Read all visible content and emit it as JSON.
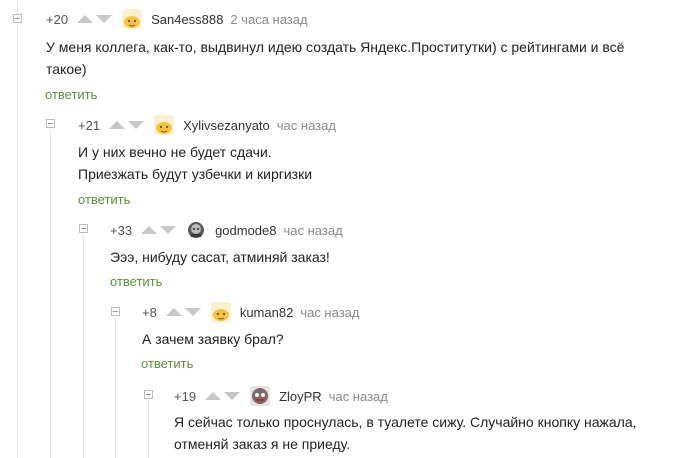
{
  "comments": [
    {
      "rating": "+20",
      "author": "San4ess888",
      "time": "2 часа назад",
      "lines": [
        "У меня коллега, как-то, выдвинул идею создать Яндекс.Проститутки) с рейтингами и всё",
        "такое)"
      ],
      "reply_label": "ответить",
      "avatar_color": "#f6c443"
    },
    {
      "rating": "+21",
      "author": "Xylivsezanyato",
      "time": "час назад",
      "lines": [
        "И у них вечно не будет сдачи.",
        "Приезжать будут узбечки и киргизки"
      ],
      "reply_label": "ответить",
      "avatar_color": "#f6c443"
    },
    {
      "rating": "+33",
      "author": "godmode8",
      "time": "час назад",
      "lines": [
        "Эээ, нибуду сасат, атминяй заказ!"
      ],
      "reply_label": "ответить",
      "avatar_color": "#5a5a5a"
    },
    {
      "rating": "+8",
      "author": "kuman82",
      "time": "час назад",
      "lines": [
        "А зачем заявку брал?"
      ],
      "reply_label": "ответить",
      "avatar_color": "#f6c443"
    },
    {
      "rating": "+19",
      "author": "ZloyPR",
      "time": "час назад",
      "lines": [
        "Я сейчас только проснулась, в туалете сижу. Случайно кнопку нажала,",
        "отменяй заказ я не приеду."
      ],
      "avatar_color": "#7a6a6a"
    }
  ]
}
